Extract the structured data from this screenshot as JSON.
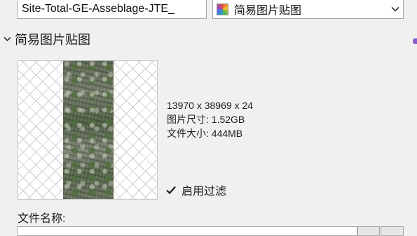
{
  "top": {
    "name_value": "Site-Total-GE-Asseblage-JTE_",
    "mode_select": {
      "value": "简易图片贴图",
      "icon": "color-swatch-icon"
    }
  },
  "section": {
    "title": "简易图片贴图",
    "icon": "chevron-down-icon"
  },
  "image_info": {
    "dimensions": "13970 x 38969 x 24",
    "image_size": "图片尺寸: 1.52GB",
    "file_size": "文件大小: 444MB"
  },
  "filter": {
    "label": "启用过滤",
    "checked": true
  },
  "file": {
    "label": "文件名称:",
    "value": ""
  },
  "colors": {
    "background": "#f0f0f0",
    "accent_dot": "#8a5cc7"
  }
}
